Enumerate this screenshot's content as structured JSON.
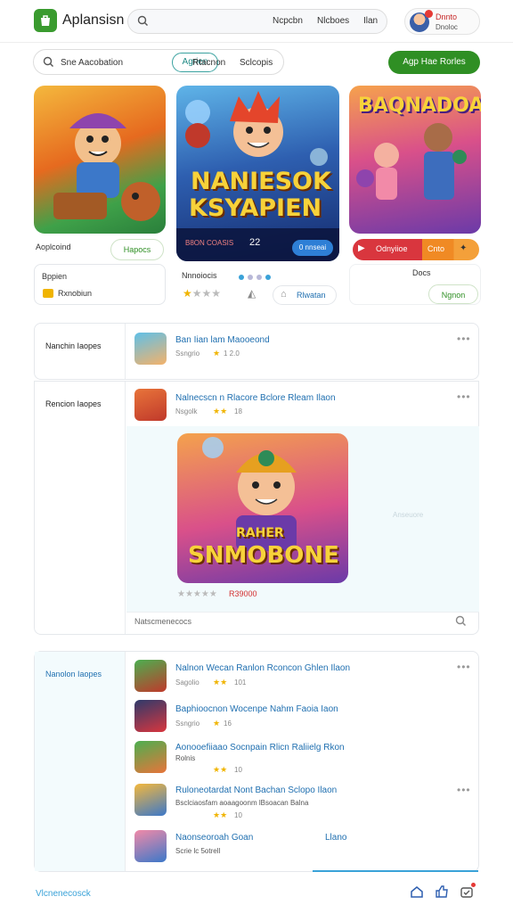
{
  "header": {
    "app_name": "Aplansisn",
    "nav": [
      "Ncpcbn",
      "Nlcboes",
      "Ilan"
    ],
    "user": {
      "name": "Dnnto",
      "sub": "Dnoloc"
    }
  },
  "filter": {
    "search_text": "Sne Aacobation",
    "tabs": [
      "Agrien",
      "Rtacnon",
      "Sclcopis"
    ],
    "cta": "Agp Hae Rorles"
  },
  "featured": {
    "card1": {
      "label": "Aoplcoind",
      "button": "Hapocs",
      "box_title": "Bppien",
      "box_item": "Rxnobiun"
    },
    "card2": {
      "title_line1": "NANIESOK",
      "title_line2": "KSYAPIEN",
      "meta": "B8ON COASIS",
      "meta_num": "22",
      "pill": "0 nnseai",
      "caption": "Nnnoiocis",
      "vote": "Rlwatan"
    },
    "card3": {
      "title": "BAQNADOALIA",
      "btn_left": "Odnyiioe",
      "btn_mid": "Cnto",
      "caption": "Docs",
      "button": "Ngnon"
    }
  },
  "section1": {
    "label": "Nanchin Iaopes",
    "items": [
      {
        "title": "Ban Iian lam Maooeond",
        "sub": "Ssngrio",
        "rating": "1 2.0"
      }
    ]
  },
  "section2": {
    "label": "Rencion Iaopes",
    "items": [
      {
        "title": "Nalnecscn n Rlacore Bclore Rleam  Ilaon",
        "sub": "Nsgolk",
        "rating": "18"
      }
    ],
    "feature": {
      "title_top": "RAHER",
      "title_main": "SNMOBONE",
      "side": "Anseuore",
      "price": "R39000"
    },
    "search_placeholder": "Natscmenecocs"
  },
  "section3": {
    "label": "Nanolon Iaopes",
    "items": [
      {
        "title": "Nalnon Wecan Ranlon Rconcon Ghlen  Ilaon",
        "sub": "Sagolio",
        "rating": "101"
      },
      {
        "title": "Baphioocnon Wocenpe Nahm Faoia  Iaon",
        "sub": "Ssngrio",
        "rating": "16"
      },
      {
        "title": "Aonooefiiaao Socnpain Rlicn Raliielg  Rkon",
        "sub": "Rolnis",
        "rating": "10"
      },
      {
        "title": "Ruloneotardat Nont Bachan Sclopo  Ilaon",
        "sub": "Bsclciaosfam aoaagoonm lBsoacan Balna",
        "rating": "10"
      },
      {
        "title": "Naonseoroah   Goan",
        "sub": "Scrie  lc  5otrell",
        "rating": "Llano"
      }
    ]
  },
  "footer": {
    "link": "Vlcnenecosck"
  },
  "colors": {
    "brand": "#3a9b2f",
    "accent": "#2f8f24",
    "link": "#1f6fb0",
    "teal": "#3aa2a0"
  }
}
